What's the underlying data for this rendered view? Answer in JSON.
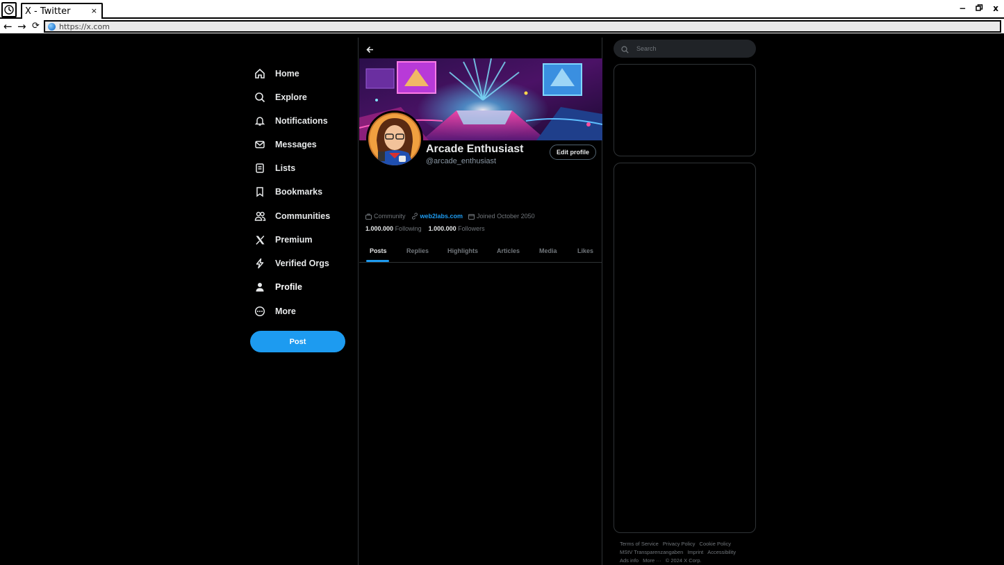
{
  "browser": {
    "tab_title": "X - Twitter",
    "tab_close": "×",
    "url": "https://x.com",
    "window_controls": [
      "−",
      "🗗",
      "x"
    ],
    "nav": {
      "back": "←",
      "forward": "→",
      "reload": "⟳"
    }
  },
  "sidebar": {
    "items": [
      {
        "label": "Home",
        "icon": "home-icon"
      },
      {
        "label": "Explore",
        "icon": "search-icon"
      },
      {
        "label": "Notifications",
        "icon": "bell-icon"
      },
      {
        "label": "Messages",
        "icon": "envelope-icon"
      },
      {
        "label": "Lists",
        "icon": "list-icon"
      },
      {
        "label": "Bookmarks",
        "icon": "bookmark-icon"
      },
      {
        "label": "Communities",
        "icon": "people-icon"
      },
      {
        "label": "Premium",
        "icon": "x-logo-icon"
      },
      {
        "label": "Verified Orgs",
        "icon": "lightning-icon"
      },
      {
        "label": "Profile",
        "icon": "person-icon"
      },
      {
        "label": "More",
        "icon": "more-circle-icon"
      }
    ],
    "post_label": "Post"
  },
  "profile": {
    "display_name": "Arcade Enthusiast",
    "handle": "@arcade_enthusiast",
    "edit_label": "Edit profile",
    "category": "Community",
    "website": "web2labs.com",
    "joined": "Joined October 2050",
    "following_count": "1.000.000",
    "following_label": "Following",
    "followers_count": "1.000.000",
    "followers_label": "Followers",
    "tabs": [
      "Posts",
      "Replies",
      "Highlights",
      "Articles",
      "Media",
      "Likes"
    ],
    "active_tab": "Posts"
  },
  "right": {
    "search_placeholder": "Search",
    "footer": {
      "line1": [
        "Terms of Service",
        "Privacy Policy",
        "Cookie Policy"
      ],
      "line2": [
        "MStV Transparenzangaben",
        "Imprint",
        "Accessibility"
      ],
      "line3": [
        "Ads info",
        "More ···",
        "© 2024 X Corp."
      ]
    }
  },
  "colors": {
    "accent": "#1d9bf0",
    "background": "#000000",
    "text": "#e7e9ea",
    "muted": "#71767b",
    "border": "#2f3336"
  }
}
